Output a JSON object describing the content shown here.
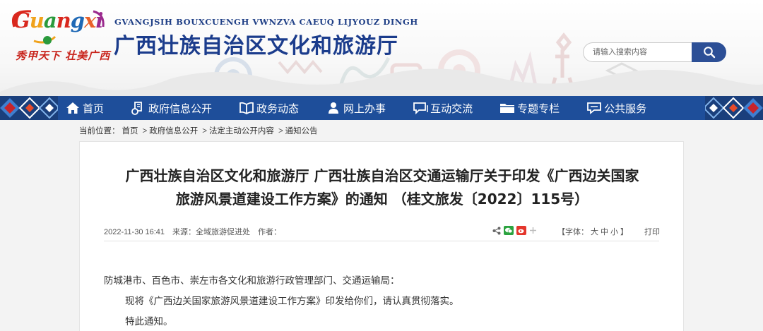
{
  "header": {
    "logo_word": [
      "G",
      "u",
      "a",
      "n",
      "g",
      "x",
      "i"
    ],
    "logo_slogan": "秀甲天下 壮美广西",
    "site_subtitle": "GVANGJSIH BOUXCUENGH VWNZVA CAEUQ LIJYOUZ DINGH",
    "site_title": "广西壮族自治区文化和旅游厅",
    "search": {
      "placeholder": "请输入搜索内容",
      "icon": "search-icon"
    }
  },
  "colors": {
    "nav_bg": "#1e4e9a",
    "title_blue": "#1b3c8c",
    "search_button": "#2c4f96",
    "slogan_red": "#c8231b"
  },
  "nav": {
    "items": [
      {
        "label": "首页",
        "icon": "home-icon"
      },
      {
        "label": "政府信息公开",
        "icon": "document-icon"
      },
      {
        "label": "政务动态",
        "icon": "open-book-icon"
      },
      {
        "label": "网上办事",
        "icon": "user-icon"
      },
      {
        "label": "互动交流",
        "icon": "chat-icon"
      },
      {
        "label": "专题专栏",
        "icon": "folder-icon"
      },
      {
        "label": "公共服务",
        "icon": "service-chat-icon"
      }
    ]
  },
  "breadcrumb": {
    "prefix": "当前位置：",
    "items": [
      "首页",
      "政府信息公开",
      "法定主动公开内容",
      "通知公告"
    ],
    "separator": ">"
  },
  "article": {
    "title_line1": "广西壮族自治区文化和旅游厅 广西壮族自治区交通运输厅关于印发《广西边关国家",
    "title_line2": "旅游风景道建设工作方案》的通知 （桂文旅发〔2022〕115号）",
    "date": "2022-11-30 16:41",
    "source": "来源：全域旅游促进处",
    "author": "作者：",
    "font_size_label": "【字体：",
    "font_sizes": [
      "大",
      "中",
      "小"
    ],
    "font_size_close": "】",
    "print": "打印",
    "share_icons": [
      "share-icon",
      "wechat-icon",
      "weibo-icon",
      "plus-icon"
    ],
    "paragraphs": [
      "防城港市、百色市、崇左市各文化和旅游行政管理部门、交通运输局：",
      "现将《广西边关国家旅游风景道建设工作方案》印发给你们，请认真贯彻落实。",
      "特此通知。"
    ]
  }
}
